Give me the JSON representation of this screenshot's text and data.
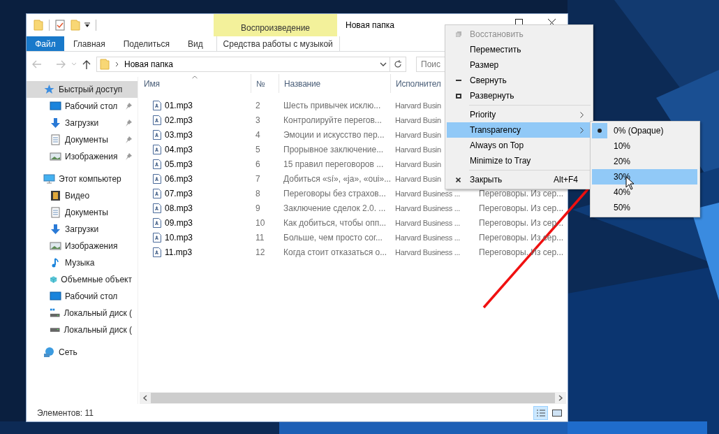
{
  "window": {
    "title": "Новая папка",
    "context_group": "Воспроизведение"
  },
  "ribbon_tabs": [
    {
      "label": "Файл",
      "kind": "file"
    },
    {
      "label": "Главная",
      "kind": "tab"
    },
    {
      "label": "Поделиться",
      "kind": "tab"
    },
    {
      "label": "Вид",
      "kind": "tab"
    },
    {
      "label": "Средства работы с музыкой",
      "kind": "context"
    }
  ],
  "address": {
    "path": "Новая папка"
  },
  "search": {
    "placeholder": "Поис"
  },
  "nav": [
    {
      "label": "Быстрый доступ",
      "kind": "star",
      "selected": true,
      "children": [
        {
          "label": "Рабочий стол",
          "kind": "desktop",
          "pinned": true,
          "selected": false
        },
        {
          "label": "Загрузки",
          "kind": "downloads",
          "pinned": true,
          "selected": false
        },
        {
          "label": "Документы",
          "kind": "documents",
          "pinned": true,
          "selected": false
        },
        {
          "label": "Изображения",
          "kind": "pictures",
          "pinned": true,
          "selected": false
        }
      ]
    },
    {
      "label": "Этот компьютер",
      "kind": "computer",
      "selected": false,
      "children": [
        {
          "label": "Видео",
          "kind": "video",
          "selected": false
        },
        {
          "label": "Документы",
          "kind": "documents",
          "selected": false
        },
        {
          "label": "Загрузки",
          "kind": "downloads",
          "selected": false
        },
        {
          "label": "Изображения",
          "kind": "pictures",
          "selected": false
        },
        {
          "label": "Музыка",
          "kind": "music",
          "selected": false
        },
        {
          "label": "Объемные объект",
          "kind": "objects",
          "selected": false
        },
        {
          "label": "Рабочий стол",
          "kind": "desktop",
          "selected": false
        },
        {
          "label": "Локальный диск (",
          "kind": "system-drive",
          "selected": false
        },
        {
          "label": "Локальный диск (",
          "kind": "drive",
          "selected": false
        }
      ]
    },
    {
      "label": "Сеть",
      "kind": "network",
      "selected": false
    }
  ],
  "columns": [
    {
      "label": "Имя",
      "sorted": true
    },
    {
      "label": "№",
      "sorted": false
    },
    {
      "label": "Название",
      "sorted": false
    },
    {
      "label": "Исполнител",
      "sorted": false
    }
  ],
  "rows": [
    {
      "name": "01.mp3",
      "number": "2",
      "title": "Шесть привычек исклю...",
      "artist": "Harvard Busin"
    },
    {
      "name": "02.mp3",
      "number": "3",
      "title": "Контролируйте перегов...",
      "artist": "Harvard Busin"
    },
    {
      "name": "03.mp3",
      "number": "4",
      "title": "Эмоции и искусство пер...",
      "artist": "Harvard Busin"
    },
    {
      "name": "04.mp3",
      "number": "5",
      "title": "Прорывное заключение...",
      "artist": "Harvard Busin"
    },
    {
      "name": "05.mp3",
      "number": "6",
      "title": "15 правил переговоров ...",
      "artist": "Harvard Busin"
    },
    {
      "name": "06.mp3",
      "number": "7",
      "title": "Добиться «sí», «ja», «oui»...",
      "artist": "Harvard Busin"
    },
    {
      "name": "07.mp3",
      "number": "8",
      "title": "Переговоры без страхов...",
      "artist": "Harvard Business ...",
      "album": "Переговоры. Из сер..."
    },
    {
      "name": "08.mp3",
      "number": "9",
      "title": "Заключение сделок 2.0. ...",
      "artist": "Harvard Business ...",
      "album": "Переговоры. Из сер..."
    },
    {
      "name": "09.mp3",
      "number": "10",
      "title": "Как добиться, чтобы опп...",
      "artist": "Harvard Business ...",
      "album": "Переговоры. Из сер..."
    },
    {
      "name": "10.mp3",
      "number": "11",
      "title": "Больше, чем просто сог...",
      "artist": "Harvard Business ...",
      "album": "Переговоры. Из сер..."
    },
    {
      "name": "11.mp3",
      "number": "12",
      "title": "Когда стоит отказаться о...",
      "artist": "Harvard Business ...",
      "album": "Переговоры. Из сер..."
    }
  ],
  "status_bar": {
    "text": "Элементов: 11",
    "views": [
      {
        "kind": "details",
        "selected": true
      },
      {
        "kind": "tiles",
        "selected": false
      }
    ]
  },
  "menu": [
    {
      "kind": "restore",
      "label": "Восстановить",
      "disabled": true,
      "selected": false,
      "submenu": false
    },
    {
      "kind": "item",
      "label": "Переместить",
      "disabled": false,
      "selected": false,
      "submenu": false
    },
    {
      "kind": "item",
      "label": "Размер",
      "disabled": false,
      "selected": false,
      "submenu": false
    },
    {
      "kind": "minimize",
      "label": "Свернуть",
      "disabled": false,
      "selected": false,
      "submenu": false
    },
    {
      "kind": "maximize",
      "label": "Развернуть",
      "disabled": false,
      "selected": false,
      "submenu": false
    },
    {
      "kind": "separator"
    },
    {
      "kind": "item",
      "label": "Priority",
      "disabled": false,
      "selected": false,
      "submenu": true
    },
    {
      "kind": "item",
      "label": "Transparency",
      "disabled": false,
      "selected": true,
      "submenu": true
    },
    {
      "kind": "item",
      "label": "Always on Top",
      "disabled": false,
      "selected": false,
      "submenu": false
    },
    {
      "kind": "item",
      "label": "Minimize to Tray",
      "disabled": false,
      "selected": false,
      "submenu": false
    },
    {
      "kind": "separator"
    },
    {
      "kind": "close",
      "label": "Закрыть",
      "shortcut": "Alt+F4",
      "disabled": false,
      "selected": false,
      "submenu": false
    }
  ],
  "submenu": [
    {
      "label": "0% (Opaque)",
      "checked": true,
      "selected": false
    },
    {
      "label": "10%",
      "checked": false,
      "selected": false
    },
    {
      "label": "20%",
      "checked": false,
      "selected": false
    },
    {
      "label": "30%",
      "checked": false,
      "selected": true
    },
    {
      "label": "40%",
      "checked": false,
      "selected": false
    },
    {
      "label": "50%",
      "checked": false,
      "selected": false
    }
  ]
}
